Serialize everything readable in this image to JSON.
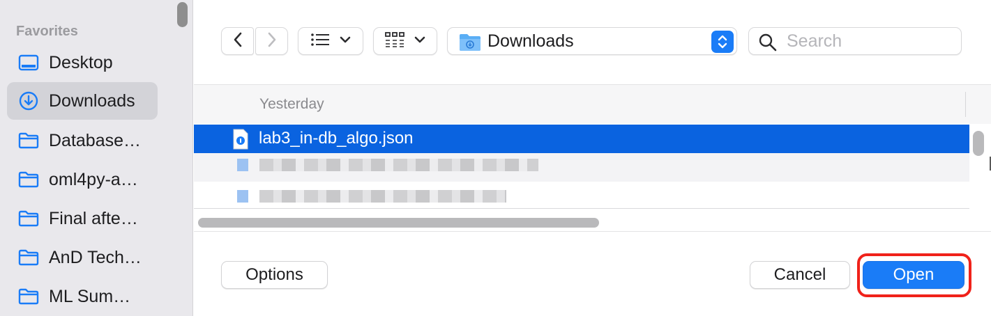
{
  "sidebar": {
    "header": "Favorites",
    "items": [
      {
        "label": "Desktop",
        "icon": "desktop-icon"
      },
      {
        "label": "Downloads",
        "icon": "download-circle-icon",
        "selected": true
      },
      {
        "label": "Database…",
        "icon": "folder-icon"
      },
      {
        "label": "oml4py-a…",
        "icon": "folder-icon"
      },
      {
        "label": "Final afte…",
        "icon": "folder-icon"
      },
      {
        "label": "AnD Tech…",
        "icon": "folder-icon"
      },
      {
        "label": "ML Sum…",
        "icon": "folder-icon"
      }
    ]
  },
  "toolbar": {
    "back_icon": "chevron-left-icon",
    "forward_icon": "chevron-right-icon",
    "list_view_icon": "list-icon",
    "grid_view_icon": "grid-icon",
    "path": "Downloads",
    "search_placeholder": "Search"
  },
  "filelist": {
    "group_header": "Yesterday",
    "rows": [
      {
        "name": "lab3_in-db_algo.json",
        "selected": true,
        "icon": "json-file-icon"
      }
    ]
  },
  "footer": {
    "options_label": "Options",
    "cancel_label": "Cancel",
    "open_label": "Open"
  },
  "colors": {
    "accent": "#1a7cf7",
    "selection": "#0a63e0",
    "highlight": "#f0221a",
    "sidebar_bg": "#e9e8ec"
  }
}
